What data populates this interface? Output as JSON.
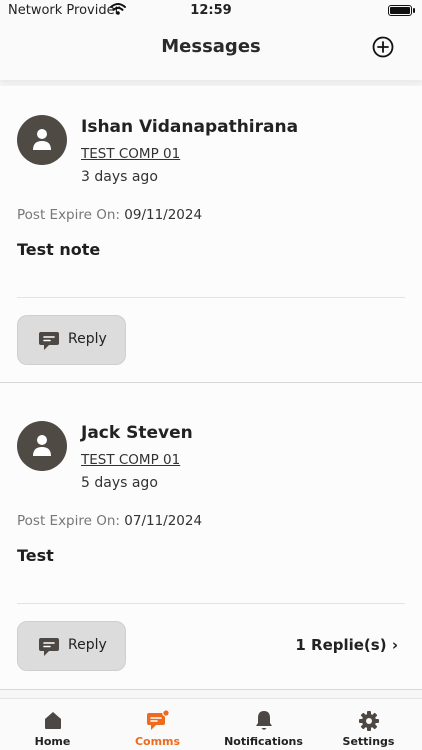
{
  "status_bar": {
    "carrier": "Network Provider",
    "time": "12:59"
  },
  "header": {
    "title": "Messages",
    "add_icon": "plus-circle-icon"
  },
  "posts": [
    {
      "author": "Ishan Vidanapathirana",
      "company": "TEST COMP 01",
      "ago": "3 days ago",
      "expire_label": "Post Expire On:",
      "expire_date": "09/11/2024",
      "note": "Test note",
      "reply_label": "Reply",
      "replies": ""
    },
    {
      "author": "Jack Steven",
      "company": "TEST COMP 01",
      "ago": "5 days ago",
      "expire_label": "Post Expire On:",
      "expire_date": "07/11/2024",
      "note": "Test",
      "reply_label": "Reply",
      "replies": "1 Replie(s)"
    }
  ],
  "tabbar": {
    "items": [
      {
        "label": "Home",
        "icon": "home-icon"
      },
      {
        "label": "Comms",
        "icon": "chat-icon",
        "active": true
      },
      {
        "label": "Notifications",
        "icon": "bell-icon"
      },
      {
        "label": "Settings",
        "icon": "gear-icon"
      }
    ]
  },
  "colors": {
    "accent": "#ee6a1e",
    "avatar_bg": "#504a45"
  }
}
